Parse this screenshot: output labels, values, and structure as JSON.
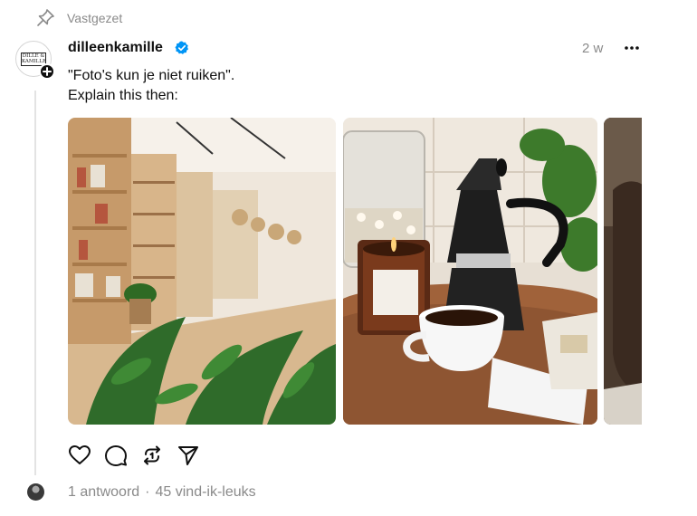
{
  "pinned": {
    "label": "Vastgezet",
    "icon": "pin-icon"
  },
  "post": {
    "username": "dilleenkamille",
    "verified_icon": "verified-badge-icon",
    "verified_color": "#0095f6",
    "avatar_text": "DILLE & KAMILLE",
    "time": "2 w",
    "text_line1": "\"Foto's kun je niet ruiken\".",
    "text_line2": "Explain this then:"
  },
  "media": [
    {
      "name": "store-interior-photo"
    },
    {
      "name": "moka-pot-coffee-photo"
    },
    {
      "name": "partial-third-photo"
    }
  ],
  "actions": [
    {
      "icon": "heart-icon"
    },
    {
      "icon": "comment-icon"
    },
    {
      "icon": "repost-icon"
    },
    {
      "icon": "share-icon"
    }
  ],
  "stats": {
    "replies": "1 antwoord",
    "separator": "·",
    "likes": "45 vind-ik-leuks"
  }
}
